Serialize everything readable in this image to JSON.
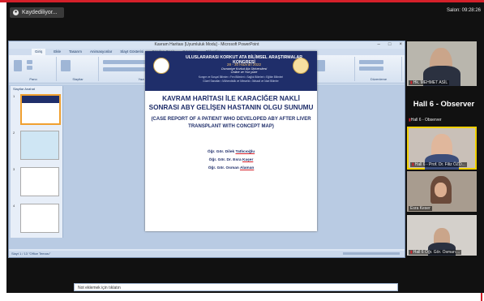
{
  "top_bar": {
    "record_label": "Kaydediliyor...",
    "clock_label": "Salon: 09:28:26"
  },
  "powerpoint": {
    "window_title": "Kavram Haritası [Uyumluluk Modu] - Microsoft PowerPoint",
    "tabs": [
      "Giriş",
      "Ekle",
      "Tasarım",
      "Animasyonlar",
      "Slayt Gösterisi",
      "Gözden Geçir",
      "Görünüm",
      "Eklentiler"
    ],
    "ribbon_groups": [
      "Pano",
      "Slaytlar",
      "Yazı Tipi",
      "Paragraf",
      "Çizim",
      "Düzenleme"
    ],
    "panel_tabs": "Slaytlar  Anahat",
    "notes_placeholder": "Not eklemek için tıklatın",
    "status_text": "Slayt 1 / 13    \"Office Teması\"",
    "thumb_numbers": [
      "1",
      "2",
      "3",
      "4"
    ]
  },
  "slide": {
    "congress_title": "ULUSLARARASI KORKUT ATA BİLİMSEL ARAŞTIRMALAR KONGRESİ",
    "dates": "28 - 30 Haziran 2022",
    "host": "Osmaniye Korkut Ata Üniversitesi",
    "mode": "Online ve Yüz yüze",
    "subline": "Kongre ve Sosyal Bilimler • Fen Bilimleri • Sağlık Bilimleri • Eğitim Bilimleri",
    "subline2": "Güzel Sanatlar • Mühendislik ve Mimarlık • İktisadi ve İdari Bilimler",
    "main_title": "KAVRAM HARİTASI İLE KARACİĞER NAKLİ SONRASI ABY GELİŞEN HASTANIN OLGU SUNUMU",
    "english_title": "(CASE REPORT OF A PATIENT WHO DEVELOPED ABY AFTER LIVER TRANSPLANT WITH CONCEPT MAP)",
    "authors": [
      {
        "title": "Öğr. Gör. Dilek",
        "surname": "Tatlıcıoğlu"
      },
      {
        "title": "Öğr. Gör. Dr. Esra",
        "surname": "Kaşer"
      },
      {
        "title": "Öğr. Gör. Osman",
        "surname": "Alaman"
      }
    ]
  },
  "participants": [
    {
      "name": "Hk. MEHMET ASİL"
    },
    {
      "name": "Hall 6 - Observer"
    },
    {
      "name": "Hall 6 - Prof. Dr. Filiz ÖZD..."
    },
    {
      "name": "Esra Keser"
    },
    {
      "name": "Hall 6 Öğr. Gör. Osman ..."
    }
  ],
  "observer_heading": "Hall 6 - Observer",
  "colors": {
    "accent_red": "#d5202a",
    "slide_navy": "#1f2e6a",
    "gold": "#f5c16c"
  }
}
